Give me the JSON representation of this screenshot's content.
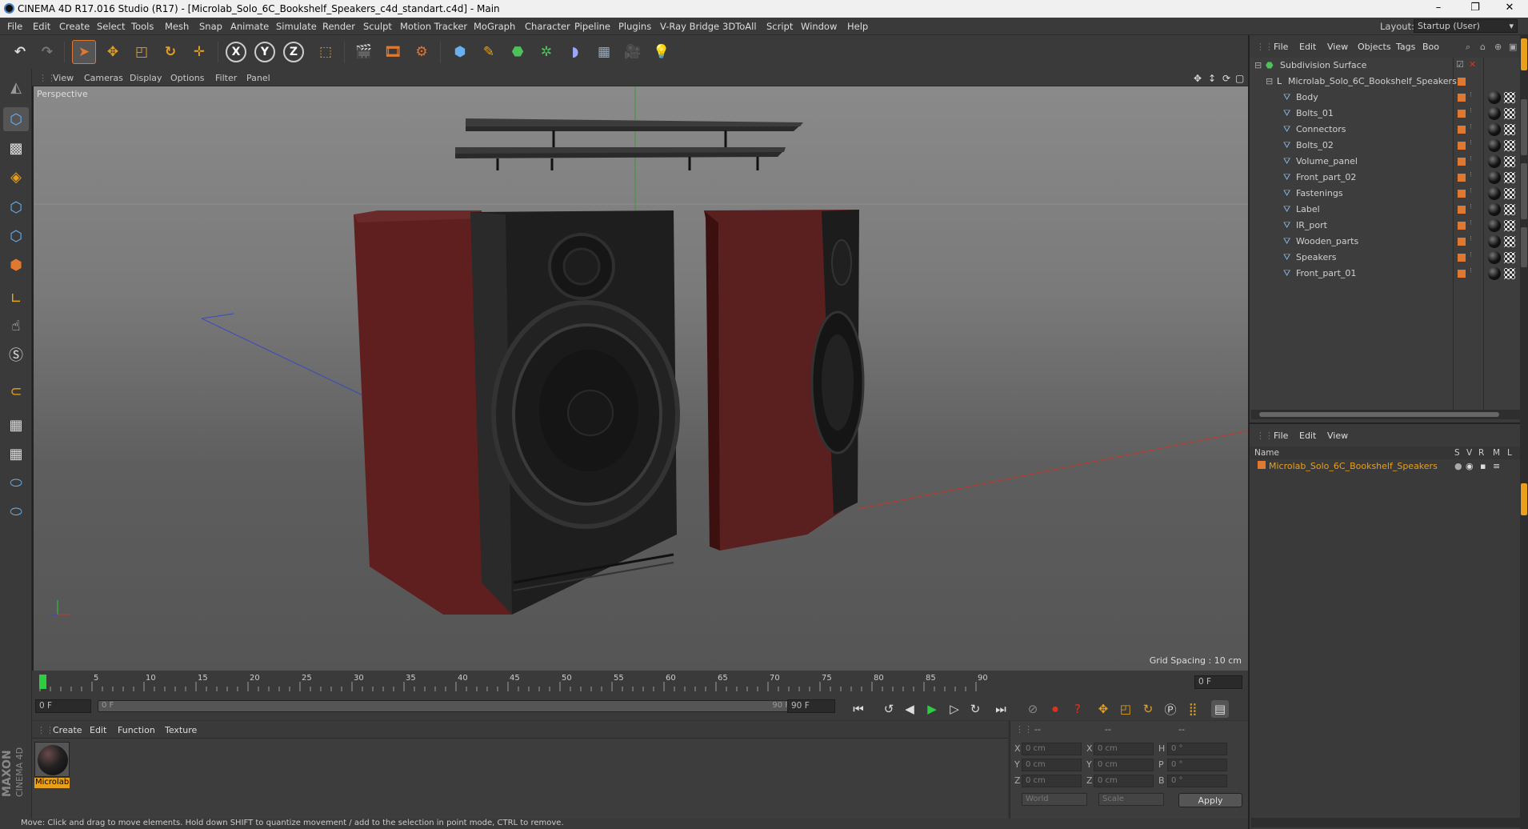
{
  "window": {
    "title": "CINEMA 4D R17.016 Studio (R17) - [Microlab_Solo_6C_Bookshelf_Speakers_c4d_standart.c4d] - Main",
    "controls": [
      "–",
      "❐",
      "✕"
    ]
  },
  "menubar": {
    "items": [
      "File",
      "Edit",
      "Create",
      "Select",
      "Tools",
      "Mesh",
      "Snap",
      "Animate",
      "Simulate",
      "Render",
      "Sculpt",
      "Motion Tracker",
      "MoGraph",
      "Character",
      "Pipeline",
      "Plugins",
      "V-Ray Bridge",
      "3DToAll",
      "Script",
      "Window",
      "Help"
    ],
    "layout_label": "Layout:",
    "layout_value": "Startup (User)"
  },
  "viewport": {
    "menu": [
      "View",
      "Cameras",
      "Display",
      "Options",
      "Filter",
      "Panel"
    ],
    "camera_label": "Perspective",
    "grid_spacing": "Grid Spacing : 10 cm"
  },
  "timeline": {
    "ticks": [
      "0",
      "5",
      "10",
      "15",
      "20",
      "25",
      "30",
      "35",
      "40",
      "45",
      "50",
      "55",
      "60",
      "65",
      "70",
      "75",
      "80",
      "85",
      "90"
    ],
    "current_frame": "0 F",
    "start_field": "0 F",
    "range_start": "0 F",
    "range_end": "90 F",
    "end_field": "90 F"
  },
  "material_manager": {
    "menu": [
      "Create",
      "Edit",
      "Function",
      "Texture"
    ],
    "materials": [
      {
        "name": "Microlab"
      }
    ]
  },
  "coordinates": {
    "header": [
      "--",
      "--",
      "--"
    ],
    "rows": [
      {
        "l1": "X",
        "v1": "0 cm",
        "l2": "X",
        "v2": "0 cm",
        "l3": "H",
        "v3": "0 °"
      },
      {
        "l1": "Y",
        "v1": "0 cm",
        "l2": "Y",
        "v2": "0 cm",
        "l3": "P",
        "v3": "0 °"
      },
      {
        "l1": "Z",
        "v1": "0 cm",
        "l2": "Z",
        "v2": "0 cm",
        "l3": "B",
        "v3": "0 °"
      }
    ],
    "mode": "World",
    "transform": "Scale",
    "apply": "Apply"
  },
  "object_manager": {
    "menu": [
      "File",
      "Edit",
      "View",
      "Objects",
      "Tags",
      "Boo"
    ],
    "objects": [
      {
        "name": "Subdivision Surface",
        "level": 0
      },
      {
        "name": "Microlab_Solo_6C_Bookshelf_Speakers",
        "level": 1
      },
      {
        "name": "Body",
        "level": 2
      },
      {
        "name": "Bolts_01",
        "level": 2
      },
      {
        "name": "Connectors",
        "level": 2
      },
      {
        "name": "Bolts_02",
        "level": 2
      },
      {
        "name": "Volume_panel",
        "level": 2
      },
      {
        "name": "Front_part_02",
        "level": 2
      },
      {
        "name": "Fastenings",
        "level": 2
      },
      {
        "name": "Label",
        "level": 2
      },
      {
        "name": "IR_port",
        "level": 2
      },
      {
        "name": "Wooden_parts",
        "level": 2
      },
      {
        "name": "Speakers",
        "level": 2
      },
      {
        "name": "Front_part_01",
        "level": 2
      }
    ]
  },
  "layer_manager": {
    "menu": [
      "File",
      "Edit",
      "View"
    ],
    "columns": {
      "name": "Name",
      "flags": [
        "S",
        "V",
        "R",
        "M",
        "L"
      ]
    },
    "rows": [
      {
        "name": "Microlab_Solo_6C_Bookshelf_Speakers"
      }
    ]
  },
  "status": "Move: Click and drag to move elements. Hold down SHIFT to quantize movement / add to the selection in point mode, CTRL to remove.",
  "brand": {
    "line1": "MAXON",
    "line2": "CINEMA 4D"
  },
  "colors": {
    "accent_orange": "#e07830",
    "selection_yellow": "#e8a01a",
    "axis_x": "#c0392b",
    "axis_y": "#2ecc40",
    "axis_z": "#3a4ac0"
  }
}
